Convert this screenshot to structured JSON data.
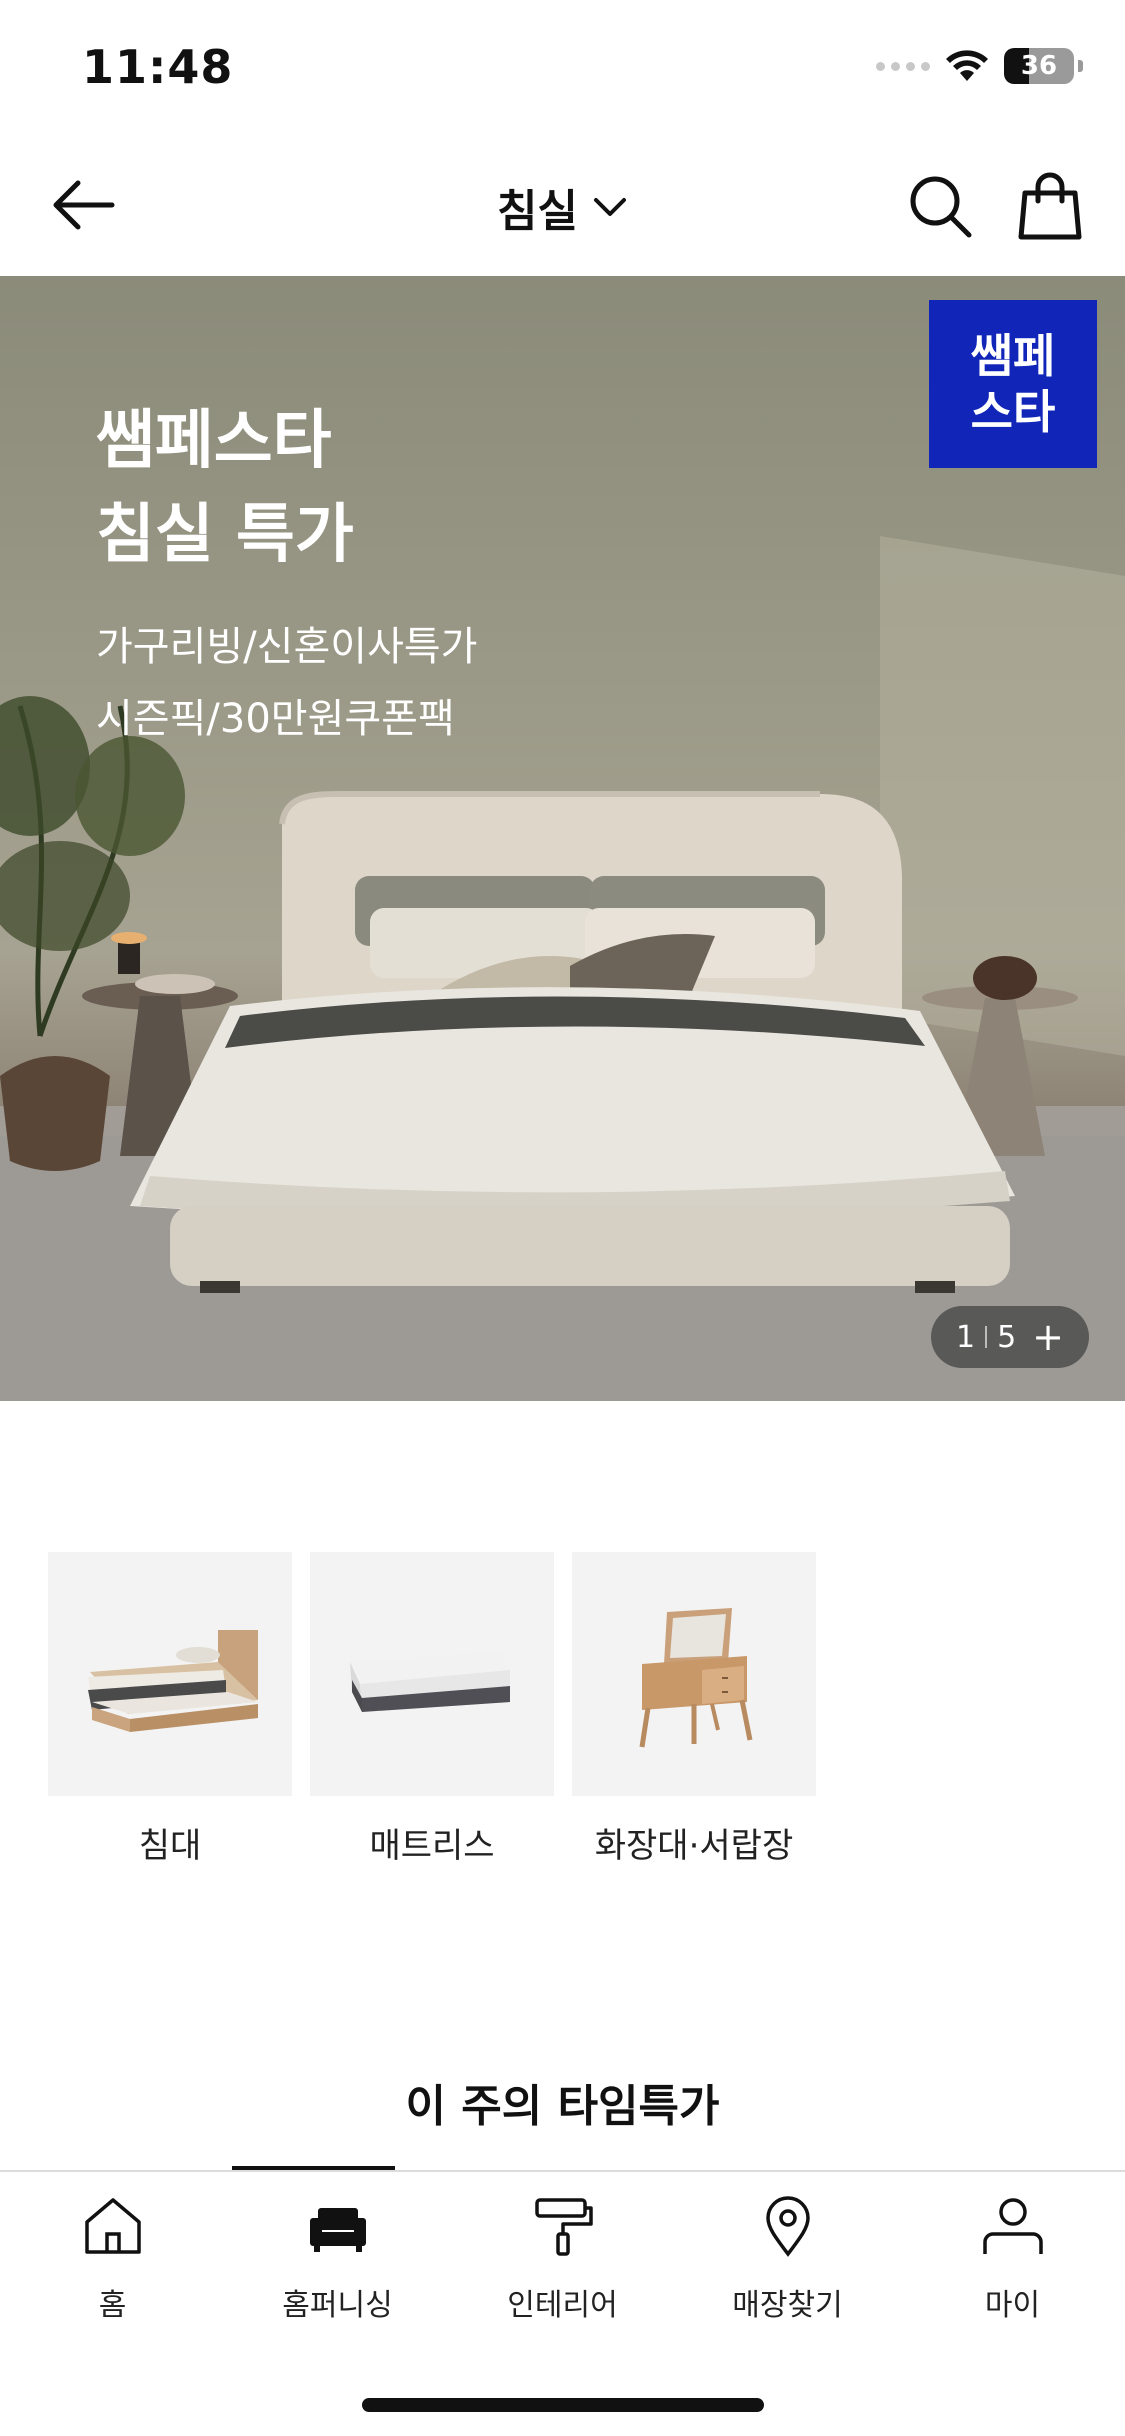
{
  "status_bar": {
    "time": "11:48",
    "battery_level": "36",
    "battery_fraction": 0.36
  },
  "nav": {
    "title": "침실",
    "back_icon": "arrow-left-icon",
    "search_icon": "search-icon",
    "bag_icon": "shopping-bag-icon",
    "chevron_icon": "chevron-down-icon"
  },
  "hero": {
    "title_line1": "쌤페스타",
    "title_line2": "침실 특가",
    "sub_line1": "가구리빙/신혼이사특가",
    "sub_line2": "시즌픽/30만원쿠폰팩",
    "badge_line1": "쌤페",
    "badge_line2": "스타",
    "badge_color": "#1125b8",
    "pager_current": "1",
    "pager_total": "5",
    "pager_plus": "+"
  },
  "categories": [
    {
      "label": "침대",
      "icon": "bed-icon"
    },
    {
      "label": "매트리스",
      "icon": "mattress-icon"
    },
    {
      "label": "화장대·서랍장",
      "icon": "vanity-icon"
    }
  ],
  "section": {
    "title": "이 주의 타임특가"
  },
  "tab_bar": {
    "items": [
      {
        "label": "홈",
        "icon": "home-icon"
      },
      {
        "label": "홈퍼니싱",
        "icon": "sofa-icon"
      },
      {
        "label": "인테리어",
        "icon": "paint-roller-icon"
      },
      {
        "label": "매장찾기",
        "icon": "location-pin-icon"
      },
      {
        "label": "마이",
        "icon": "person-icon"
      }
    ]
  }
}
